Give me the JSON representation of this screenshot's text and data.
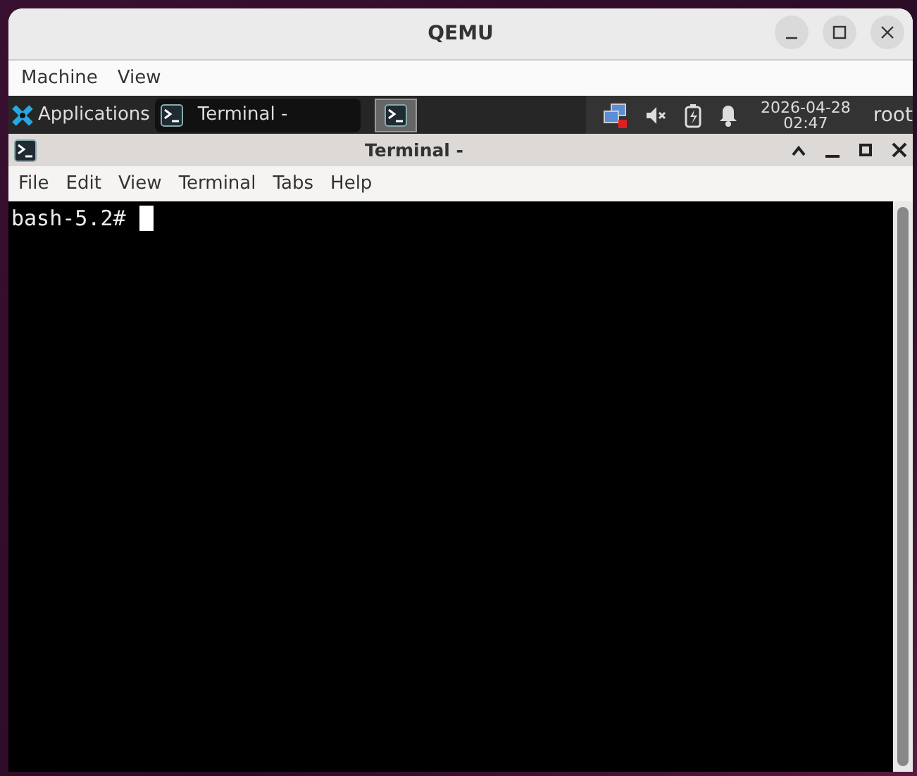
{
  "window": {
    "title": "QEMU"
  },
  "menu": [
    "Machine",
    "View"
  ],
  "guest_panel": {
    "applications": "Applications",
    "tasks": [
      {
        "label": "Terminal -",
        "selected": false
      }
    ],
    "date": "2026-04-28",
    "time": "02:47",
    "user": "root"
  },
  "terminal": {
    "title": "Terminal -",
    "menu": [
      "File",
      "Edit",
      "View",
      "Terminal",
      "Tabs",
      "Help"
    ],
    "lines": [
      "bash-5.2#"
    ]
  }
}
